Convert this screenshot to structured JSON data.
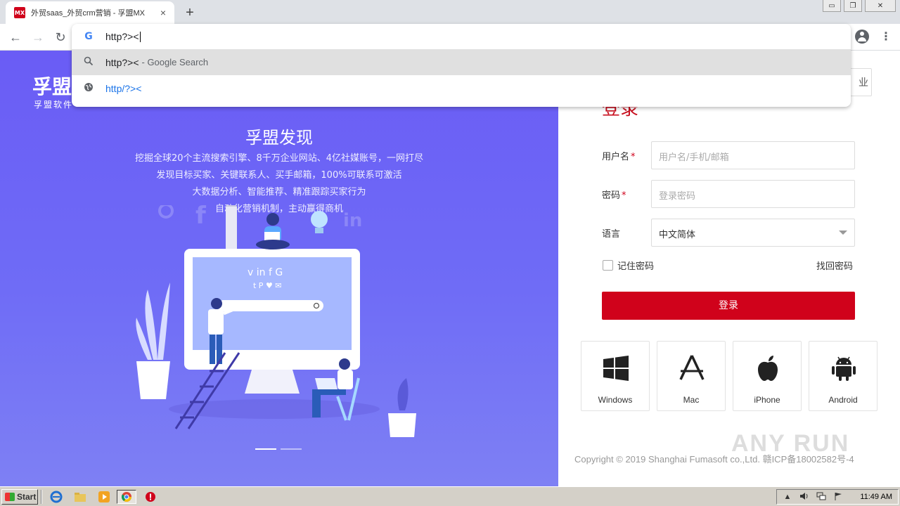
{
  "browser": {
    "tab": {
      "favicon_text": "MX",
      "title": "外贸saas_外贸crm营销 - 孚盟MX",
      "close": "×"
    },
    "new_tab": "+",
    "window_controls": {
      "minimize": "▭",
      "restore": "❐",
      "close": "✕"
    },
    "nav": {
      "back": "←",
      "forward": "→",
      "reload": "↻"
    },
    "menu": "⋮",
    "omnibox": {
      "g_icon": "G",
      "input_value": "http?><",
      "suggestions": [
        {
          "icon": "search-icon",
          "text": "http?><",
          "suffix": "- Google Search"
        },
        {
          "icon": "globe-icon",
          "text": "http/?><"
        }
      ]
    }
  },
  "hero": {
    "brand_title": "孚盟",
    "brand_subtitle": "孚盟软件",
    "title": "孚盟发现",
    "lines": [
      "挖掘全球20个主流搜索引擎、8千万企业网站、4亿社媒账号，一网打尽",
      "发现目标买家、关键联系人、买手邮箱，100%可联系可激活",
      "大数据分析、智能推荐、精准跟踪买家行为",
      "自动化营销机制，主动赢得商机"
    ]
  },
  "login": {
    "enterprise_label": "业",
    "title": "登录",
    "username_label": "用户名",
    "username_placeholder": "用户名/手机/邮箱",
    "password_label": "密码",
    "password_placeholder": "登录密码",
    "language_label": "语言",
    "language_value": "中文简体",
    "required_mark": "*",
    "remember_label": "记住密码",
    "forgot_label": "找回密码",
    "submit_label": "登录",
    "downloads": [
      {
        "label": "Windows",
        "icon": "windows-icon"
      },
      {
        "label": "Mac",
        "icon": "app-store-icon"
      },
      {
        "label": "iPhone",
        "icon": "apple-icon"
      },
      {
        "label": "Android",
        "icon": "android-icon"
      }
    ],
    "copyright": "Copyright © 2019 Shanghai Fumasoft co.,Ltd.  赣ICP备18002582号-4"
  },
  "watermark": "ANY RUN",
  "taskbar": {
    "start_label": "Start",
    "clock": "11:49 AM"
  },
  "colors": {
    "brand_red": "#d0021b",
    "hero_purple": "#6a5cf5"
  }
}
